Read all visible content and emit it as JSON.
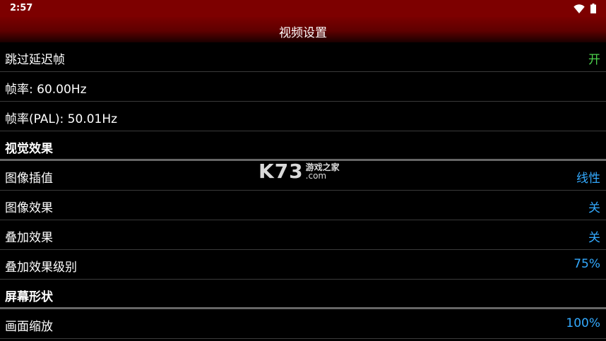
{
  "status_bar": {
    "time": "2:57",
    "icons": [
      "wifi-icon",
      "battery-icon"
    ]
  },
  "header": {
    "title": "视频设置"
  },
  "watermark": {
    "brand": "K73",
    "name": "游戏之家",
    "domain": ".com"
  },
  "settings": {
    "skip_delay_frames": {
      "label": "跳过延迟帧",
      "value": "开"
    },
    "frame_rate": {
      "label": "帧率: 60.00Hz"
    },
    "frame_rate_pal": {
      "label": "帧率(PAL): 50.01Hz"
    },
    "visual_effects_header": {
      "label": "视觉效果"
    },
    "image_interpolation": {
      "label": "图像插值",
      "value": "线性"
    },
    "image_effect": {
      "label": "图像效果",
      "value": "关"
    },
    "overlay_effect": {
      "label": "叠加效果",
      "value": "关"
    },
    "overlay_effect_level": {
      "label": "叠加效果级别",
      "value": "75%"
    },
    "screen_shape_header": {
      "label": "屏幕形状"
    },
    "screen_scale": {
      "label": "画面缩放",
      "value": "100%"
    }
  },
  "colors": {
    "status_bar": "#7d0000",
    "title_bar": "#6a0000",
    "value_blue": "#33aaff",
    "value_green": "#4cd14c"
  }
}
